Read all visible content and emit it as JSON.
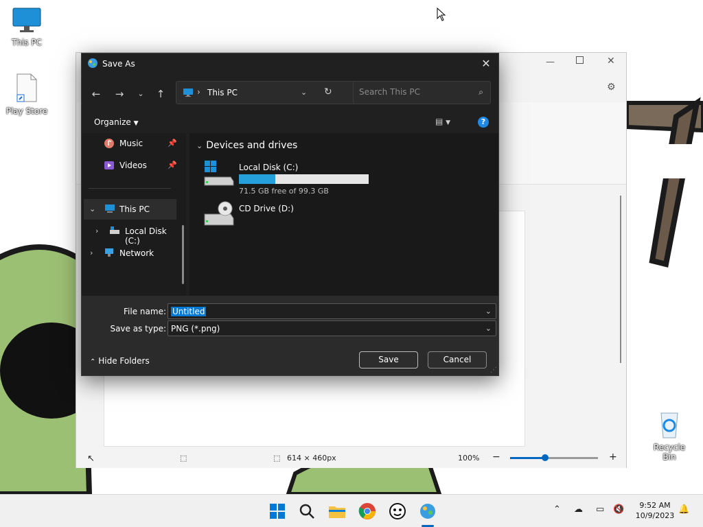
{
  "desktop": {
    "icons": [
      {
        "label": "This PC",
        "icon": "monitor-icon"
      },
      {
        "label": "Play Store",
        "icon": "document-shortcut-icon"
      },
      {
        "label": "Recycle Bin",
        "icon": "recycle-bin-icon"
      }
    ]
  },
  "paint": {
    "status": {
      "canvas_size": "614 × 460px",
      "zoom": "100%"
    }
  },
  "dialog": {
    "title": "Save As",
    "close_symbol": "✕",
    "address": {
      "current": "This PC",
      "separator": "›"
    },
    "search": {
      "placeholder": "Search This PC"
    },
    "toolbar": {
      "organize": "Organize",
      "help": "?"
    },
    "nav": {
      "quick": [
        {
          "label": "Music",
          "icon": "music-icon",
          "pinned": true
        },
        {
          "label": "Videos",
          "icon": "videos-icon",
          "pinned": true
        }
      ],
      "tree": [
        {
          "label": "This PC",
          "icon": "monitor-icon",
          "expanded": true,
          "selected": true
        },
        {
          "label": "Local Disk (C:)",
          "icon": "disk-icon",
          "expanded": false
        },
        {
          "label": "Network",
          "icon": "network-icon",
          "expanded": false
        }
      ]
    },
    "content": {
      "group": "Devices and drives",
      "drives": [
        {
          "name": "Local Disk (C:)",
          "free": "71.5 GB free of 99.3 GB",
          "used_fraction": 0.28,
          "icon": "windows-drive-icon"
        },
        {
          "name": "CD Drive (D:)",
          "icon": "cd-drive-icon"
        }
      ]
    },
    "form": {
      "file_name_label": "File name:",
      "file_name_value": "Untitled",
      "save_type_label": "Save as type:",
      "save_type_value": "PNG (*.png)"
    },
    "hide_folders": "Hide Folders",
    "save": "Save",
    "cancel": "Cancel"
  },
  "taskbar": {
    "time": "9:52 AM",
    "date": "10/9/2023"
  },
  "colors": {
    "dialog_bg": "#202020",
    "bottom_bg": "#2b2b2b",
    "accent": "#0078d4",
    "usage_bar": "#26a0da"
  }
}
